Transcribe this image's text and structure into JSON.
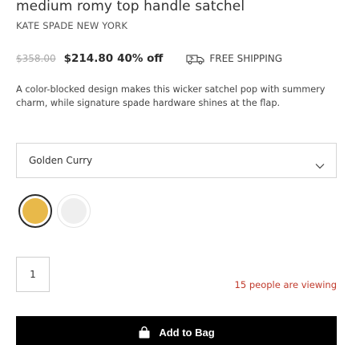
{
  "product": {
    "title": "medium romy top handle satchel",
    "brand": "KATE SPADE NEW YORK",
    "description": "A color-blocked design makes this wicker satchel pop with summery charm, while signature spade hardware shines at the flap."
  },
  "pricing": {
    "original_price": "$358.00",
    "sale_price": "$214.80",
    "discount": "40% off",
    "shipping_label": "FREE SHIPPING",
    "shipping_icon": "truck-icon"
  },
  "color_select": {
    "selected": "Golden Curry",
    "icon": "chevron-down-icon",
    "swatches": [
      {
        "name": "Golden Curry",
        "color": "#e8b94a",
        "selected": true
      },
      {
        "name": "",
        "color": "#efefef",
        "selected": false
      }
    ]
  },
  "quantity": {
    "value": "1"
  },
  "viewing": {
    "count": "15",
    "label": "people are viewing",
    "color": "#c0392b"
  },
  "add_to_bag": {
    "label": "Add to Bag",
    "icon": "shopping-bag-icon"
  }
}
